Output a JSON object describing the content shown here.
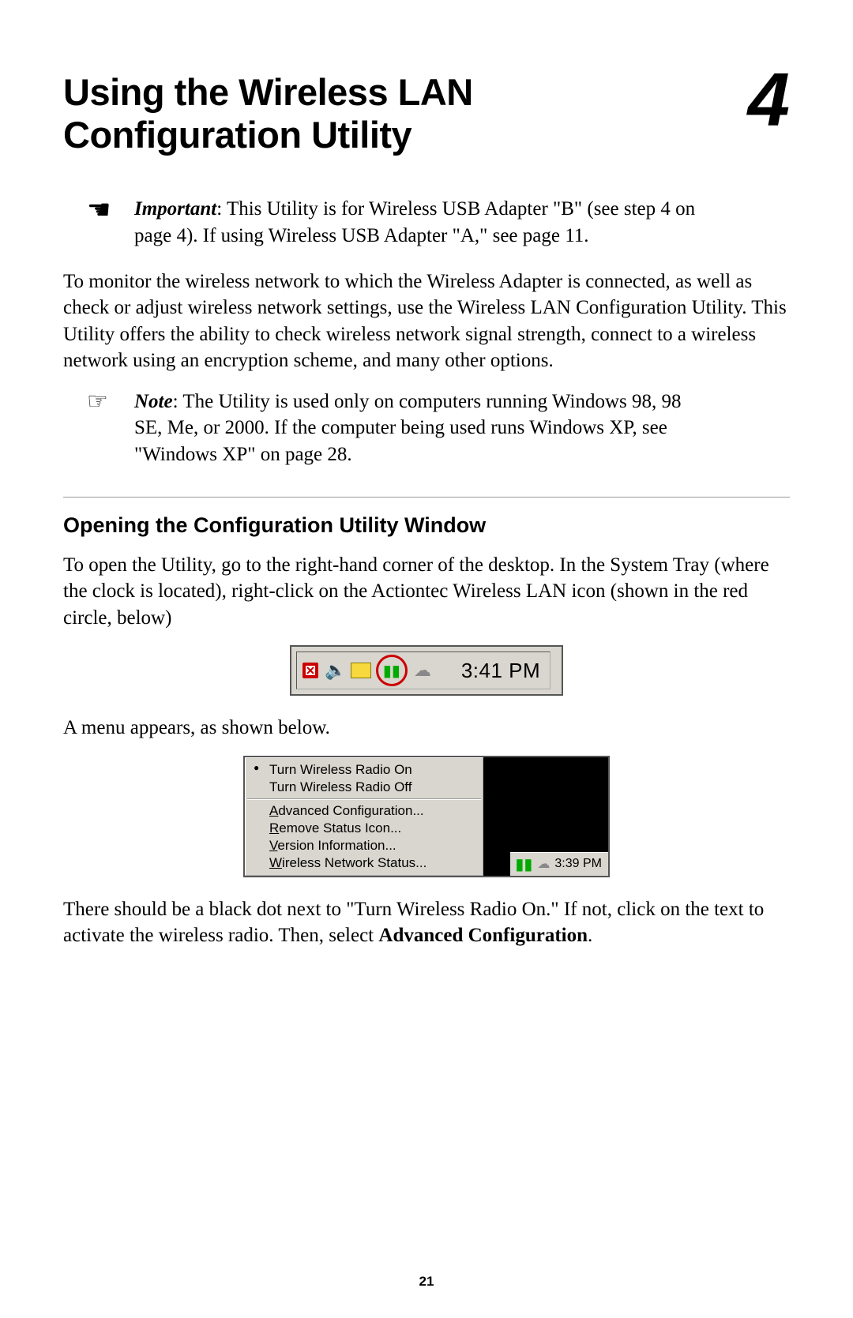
{
  "chapter": {
    "title_line1": "Using the Wireless LAN",
    "title_line2": "Configuration Utility",
    "number": "4"
  },
  "important": {
    "label": "Important",
    "text": ": This Utility is for Wireless USB Adapter \"B\" (see step 4 on page 4). If using Wireless USB Adapter \"A,\" see page 11."
  },
  "intro_paragraph": "To monitor the wireless network to which the Wireless Adapter is connected, as well as check or adjust wireless network settings, use the Wireless LAN Configuration Utility. This Utility offers the ability to check wireless network signal strength, connect to a wireless network using an encryption scheme, and many other options.",
  "note": {
    "label": "Note",
    "text": ": The Utility is used only on computers running Windows 98, 98 SE, Me, or 2000. If the computer being used runs Windows XP, see \"Windows XP\" on page 28."
  },
  "section_heading": "Opening the Configuration Utility Window",
  "open_paragraph": "To open the Utility, go to the right-hand corner of the desktop. In the System Tray (where the clock is located), right-click on the Actiontec Wireless LAN icon (shown in the red circle, below)",
  "tray": {
    "clock": "3:41 PM",
    "icons": [
      "pdf-icon",
      "volume-icon",
      "battery-icon",
      "wireless-lan-icon",
      "cloud-icon"
    ]
  },
  "after_tray_paragraph": "A menu appears, as shown below.",
  "context_menu": {
    "items_top": [
      {
        "label": "Turn Wireless Radio On",
        "dot": true
      },
      {
        "label": "Turn Wireless Radio Off",
        "dot": false
      }
    ],
    "items_bottom": [
      {
        "ul": "A",
        "rest": "dvanced Configuration..."
      },
      {
        "ul": "R",
        "rest": "emove Status Icon..."
      },
      {
        "ul": "V",
        "rest": "ersion Information..."
      },
      {
        "ul": "W",
        "rest": "ireless Network Status..."
      }
    ],
    "mini_clock": "3:39 PM"
  },
  "closing_paragraph_pre": "There should be a black dot next to \"Turn Wireless Radio On.\" If not, click on the text to activate the wireless radio. Then, select ",
  "closing_paragraph_bold": "Advanced Configuration",
  "closing_paragraph_post": ".",
  "page_number": "21"
}
